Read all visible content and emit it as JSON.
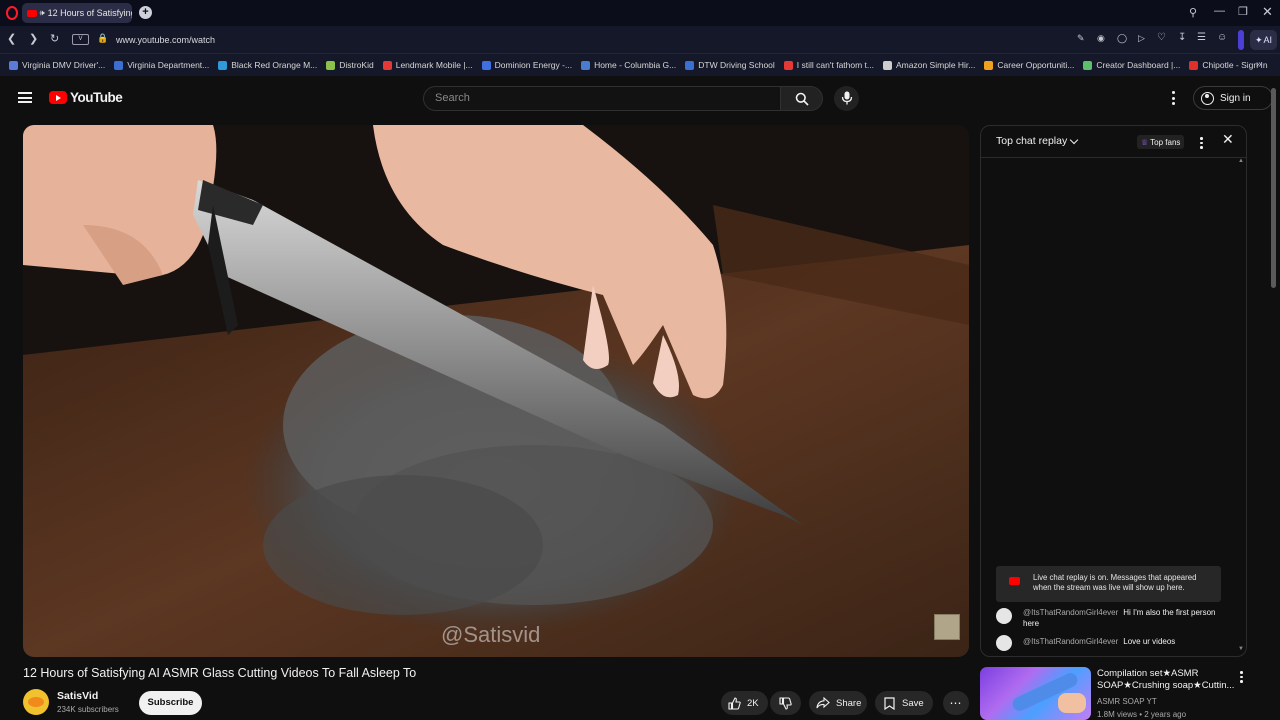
{
  "browser": {
    "tab_title": "12 Hours of Satisfying",
    "url": "www.youtube.com/watch",
    "ai_label": "AI",
    "bookmarks": [
      "Virginia DMV Driver'...",
      "Virginia Department...",
      "Black Red Orange M...",
      "DistroKid",
      "Lendmark Mobile |...",
      "Dominion Energy -...",
      "Home - Columbia G...",
      "DTW Driving School",
      "I still can't fathom t...",
      "Amazon Simple Hir...",
      "Career Opportuniti...",
      "Creator Dashboard |...",
      "Chipotle - Sign In"
    ],
    "bookmark_colors": [
      "#5a7bd8",
      "#3b6fd1",
      "#2f9ad8",
      "#8bc34a",
      "#e53935",
      "#3f6fe0",
      "#4a7bd0",
      "#3b6fd1",
      "#e53935",
      "#cccccc",
      "#f0a020",
      "#5cc06a",
      "#e0302a"
    ]
  },
  "youtube": {
    "logo_text": "YouTube",
    "search_placeholder": "Search",
    "sign_in_label": "Sign in",
    "watermark": "@Satisvid",
    "video_title": "12 Hours of Satisfying AI ASMR Glass Cutting Videos To Fall Asleep To",
    "channel_name": "SatisVid",
    "subscribers": "234K subscribers",
    "subscribe_label": "Subscribe",
    "like_count": "2K",
    "share_label": "Share",
    "save_label": "Save"
  },
  "chat": {
    "header_label": "Top chat replay",
    "top_fans_label": "Top fans",
    "notice": "Live chat replay is on. Messages that appeared when the stream was live will show up here.",
    "messages": [
      {
        "author": "@ItsThatRandomGirl4ever",
        "text": "Hi I'm also the first person here"
      },
      {
        "author": "@ItsThatRandomGirl4ever",
        "text": "Love ur videos"
      }
    ]
  },
  "recommendation": {
    "title": "Compilation set★ASMR SOAP★Crushing soap★Cuttin...",
    "channel": "ASMR SOAP YT",
    "meta": "1.8M views • 2 years ago"
  },
  "colors": {
    "youtube_red": "#ff0000",
    "link_blue": "#3ea6ff",
    "background": "#0f0f0f"
  }
}
